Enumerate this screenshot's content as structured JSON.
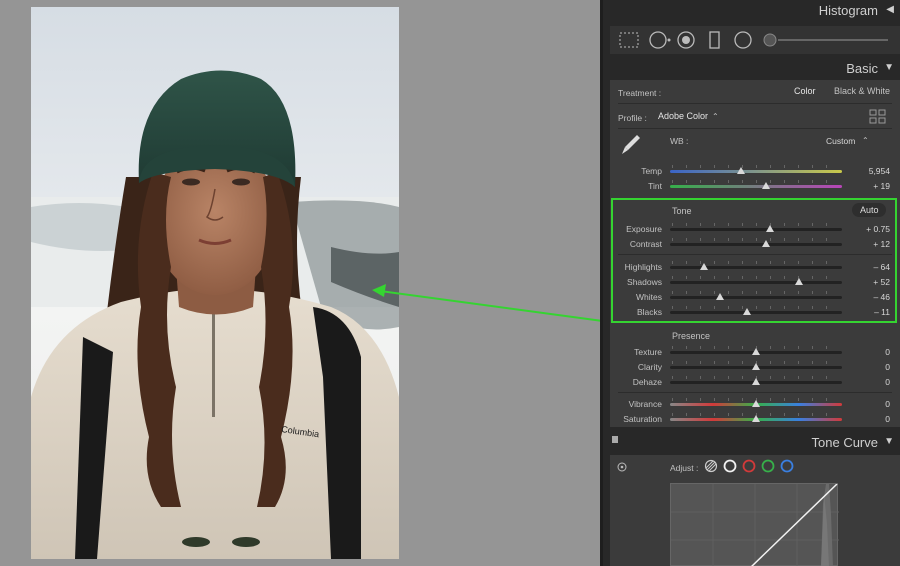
{
  "panel": {
    "histogram_label": "Histogram",
    "basic_label": "Basic",
    "tone_curve_label": "Tone Curve",
    "collapse_arrow": "◀",
    "expand_arrow": "▼",
    "treatment": {
      "label": "Treatment :",
      "color": "Color",
      "bw": "Black & White"
    },
    "profile": {
      "label": "Profile :",
      "value": "Adobe Color",
      "chevron": "⌃"
    },
    "wb": {
      "label": "WB :",
      "value": "Custom",
      "chevron": "⌃"
    },
    "tone": {
      "label": "Tone",
      "auto": "Auto"
    },
    "presence": {
      "label": "Presence"
    },
    "adjust": {
      "label": "Adjust :"
    }
  },
  "sliders": {
    "temp": {
      "label": "Temp",
      "value": "5,954",
      "pos": 0.41
    },
    "tint": {
      "label": "Tint",
      "value": "+ 19",
      "pos": 0.56
    },
    "exposure": {
      "label": "Exposure",
      "value": "+ 0.75",
      "pos": 0.58
    },
    "contrast": {
      "label": "Contrast",
      "value": "+ 12",
      "pos": 0.56
    },
    "highlights": {
      "label": "Highlights",
      "value": "– 64",
      "pos": 0.2
    },
    "shadows": {
      "label": "Shadows",
      "value": "+ 52",
      "pos": 0.75
    },
    "whites": {
      "label": "Whites",
      "value": "– 46",
      "pos": 0.29
    },
    "blacks": {
      "label": "Blacks",
      "value": "– 11",
      "pos": 0.45
    },
    "texture": {
      "label": "Texture",
      "value": "0",
      "pos": 0.5
    },
    "clarity": {
      "label": "Clarity",
      "value": "0",
      "pos": 0.5
    },
    "dehaze": {
      "label": "Dehaze",
      "value": "0",
      "pos": 0.5
    },
    "vibrance": {
      "label": "Vibrance",
      "value": "0",
      "pos": 0.5
    },
    "saturation": {
      "label": "Saturation",
      "value": "0",
      "pos": 0.5
    }
  },
  "photo": {
    "brand_text": "Columbia"
  },
  "colors": {
    "highlight": "#35d431",
    "accent_red": "#d23a3a",
    "accent_green": "#37b04a",
    "accent_blue": "#3a7fe0"
  }
}
